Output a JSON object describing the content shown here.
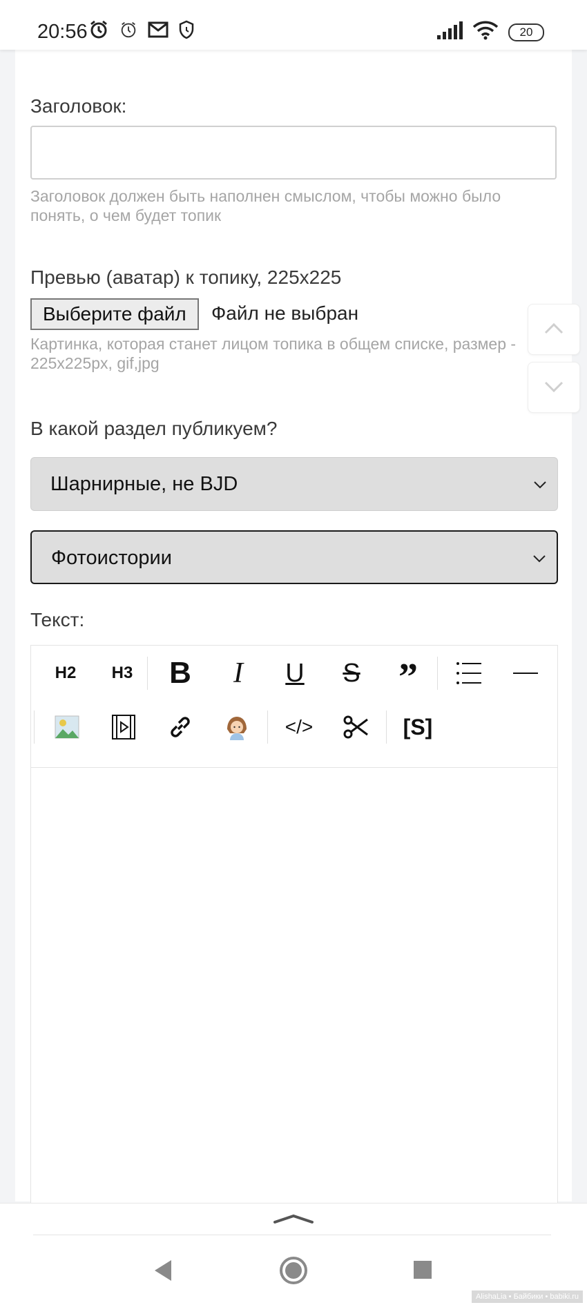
{
  "status_bar": {
    "time": "20:56",
    "battery": "20",
    "icons_left": [
      "alarm-icon",
      "alarm-clock-icon",
      "mail-icon",
      "shield-icon"
    ],
    "icons_right": [
      "signal-icon",
      "wifi-icon",
      "battery-icon"
    ]
  },
  "form": {
    "title_label": "Заголовок:",
    "title_value": "",
    "title_hint": "Заголовок должен быть наполнен смыслом, чтобы можно было понять, о чем будет топик",
    "preview_label": "Превью (аватар) к топику, 225x225",
    "file_button": "Выберите файл",
    "file_status": "Файл не выбран",
    "preview_hint": "Картинка, которая станет лицом топика в общем списке, размер - 225x225px, gif,jpg",
    "section_label": "В какой раздел публикуем?",
    "section_select": "Шарнирные, не BJD",
    "subsection_select": "Фотоистории",
    "text_label": "Текст:"
  },
  "editor_toolbar": {
    "h2": "H2",
    "h3": "H3",
    "bold": "B",
    "italic": "I",
    "underline": "U",
    "strike": "S",
    "quote": "”",
    "code": "</>",
    "spoiler": "[S]"
  },
  "colors": {
    "hint": "#a5a5a5",
    "select_bg": "#dedede",
    "page_bg": "#f3f4f6"
  },
  "watermark": "AlishaLia • Байбики • babiki.ru"
}
